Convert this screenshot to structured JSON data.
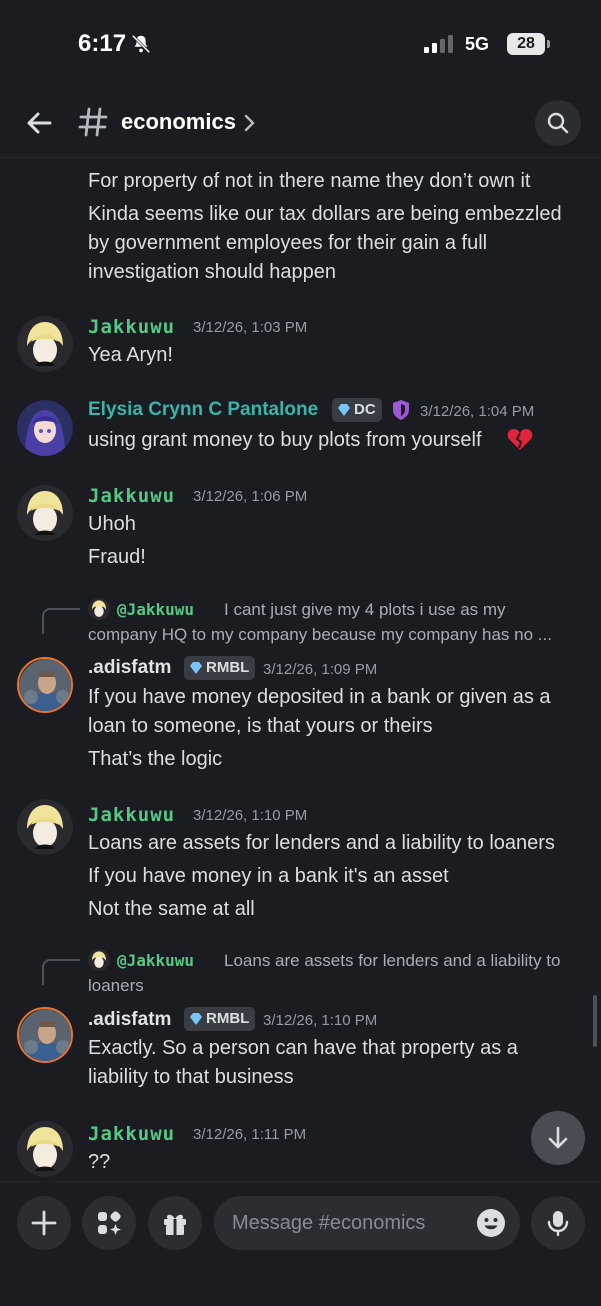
{
  "status": {
    "time": "6:17",
    "network": "5G",
    "battery": "28"
  },
  "header": {
    "channel": "economics"
  },
  "messages": {
    "cont": [
      "For property of not in there name they don’t own it",
      "Kinda seems like our tax dollars are being embezzled",
      "by government employees for their gain a full",
      "investigation should happen"
    ],
    "m1": {
      "author": "Jakkuwu",
      "time": "3/12/26, 1:03 PM",
      "lines": [
        "Yea Aryn!"
      ]
    },
    "m2": {
      "author": "Elysia Crynn C Pantalone",
      "tag": "DC",
      "time": "3/12/26, 1:04 PM",
      "lines": [
        "using grant money to buy plots from yourself"
      ]
    },
    "m3": {
      "author": "Jakkuwu",
      "time": "3/12/26, 1:06 PM",
      "lines": [
        "Uhoh",
        "Fraud!"
      ]
    },
    "m4": {
      "reply_user": "@Jakkuwu",
      "reply_text_1": "I cant just give my 4 plots i use as my",
      "reply_text_2": "company HQ to my company because my company has no ...",
      "author": ".adisfatm",
      "tag": "RMBL",
      "time": "3/12/26, 1:09 PM",
      "lines": [
        "If you have money deposited in a bank or given as a",
        "loan to someone, is that yours or theirs",
        "That’s the logic"
      ]
    },
    "m5": {
      "author": "Jakkuwu",
      "time": "3/12/26, 1:10 PM",
      "lines": [
        "Loans are assets for lenders and a liability to loaners",
        "If you have money in a bank it's an asset",
        "Not the same at all"
      ]
    },
    "m6": {
      "reply_user": "@Jakkuwu",
      "reply_text_1": "Loans are assets for lenders and a liability to",
      "reply_text_2": "loaners",
      "author": ".adisfatm",
      "tag": "RMBL",
      "time": "3/12/26, 1:10 PM",
      "lines": [
        "Exactly. So a person can have that property as a",
        "liability to that business"
      ]
    },
    "m7": {
      "author": "Jakkuwu",
      "time": "3/12/26, 1:11 PM",
      "lines": [
        "??"
      ]
    }
  },
  "composer": {
    "placeholder": "Message #economics"
  },
  "colors": {
    "background": "#1b1c21",
    "jakkuwu": "#57c785",
    "elysia": "#37b5a8",
    "surface": "#2b2d33"
  }
}
